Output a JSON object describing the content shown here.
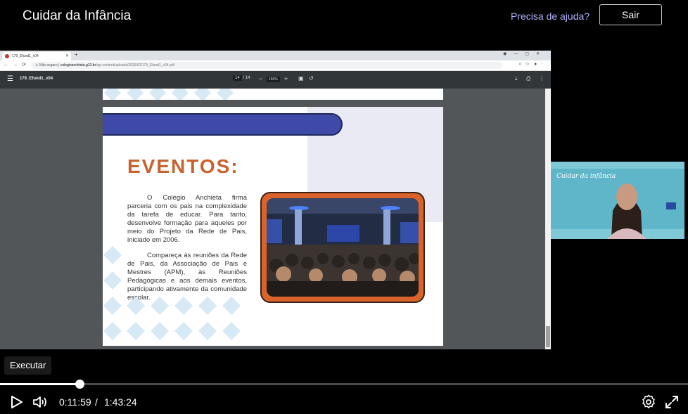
{
  "header": {
    "title": "Cuidar da Infância",
    "help_link": "Precisa de ajuda?",
    "exit_button": "Sair"
  },
  "browser": {
    "tab_title": "179_Efund1_v04",
    "security_label": "Não seguro",
    "url_host": "colegioanchieta.g12.br",
    "url_path": "/wp-content/uploads/2020/02/179_Efund1_v04.pdf"
  },
  "pdf_viewer": {
    "file_name": "179_Efund1_v04",
    "current_page": "14",
    "page_separator": "/",
    "total_pages": "14",
    "zoom": "150%"
  },
  "slide": {
    "heading": "EVENTOS:",
    "paragraph_1": "O Colégio Anchieta firma parceria com os pais na complexidade da tarefa de educar. Para tanto, desenvolve formação para aqueles por meio do Projeto da Rede de Pais, iniciado em 2006.",
    "paragraph_2": "Compareça às reuniões da Rede de Pais, da Associação de Pais e Mestres (APM), às Reuniões Pedagógicas e aos demais eventos, participando ativamente da comunidade escolar.",
    "colors": {
      "heading": "#c9622d",
      "banner": "#3f4aa8",
      "photo_frame": "#d9632b",
      "diamond": "#d6e9f5"
    }
  },
  "webcam": {
    "banner_text": "Cuidar da infância"
  },
  "player": {
    "tooltip": "Executar",
    "current_time": "0:11:59",
    "time_separator": "/",
    "total_time": "1:43:24",
    "progress": 0.116,
    "icons": [
      "play-icon",
      "volume-icon",
      "settings-icon",
      "fullscreen-icon"
    ]
  }
}
